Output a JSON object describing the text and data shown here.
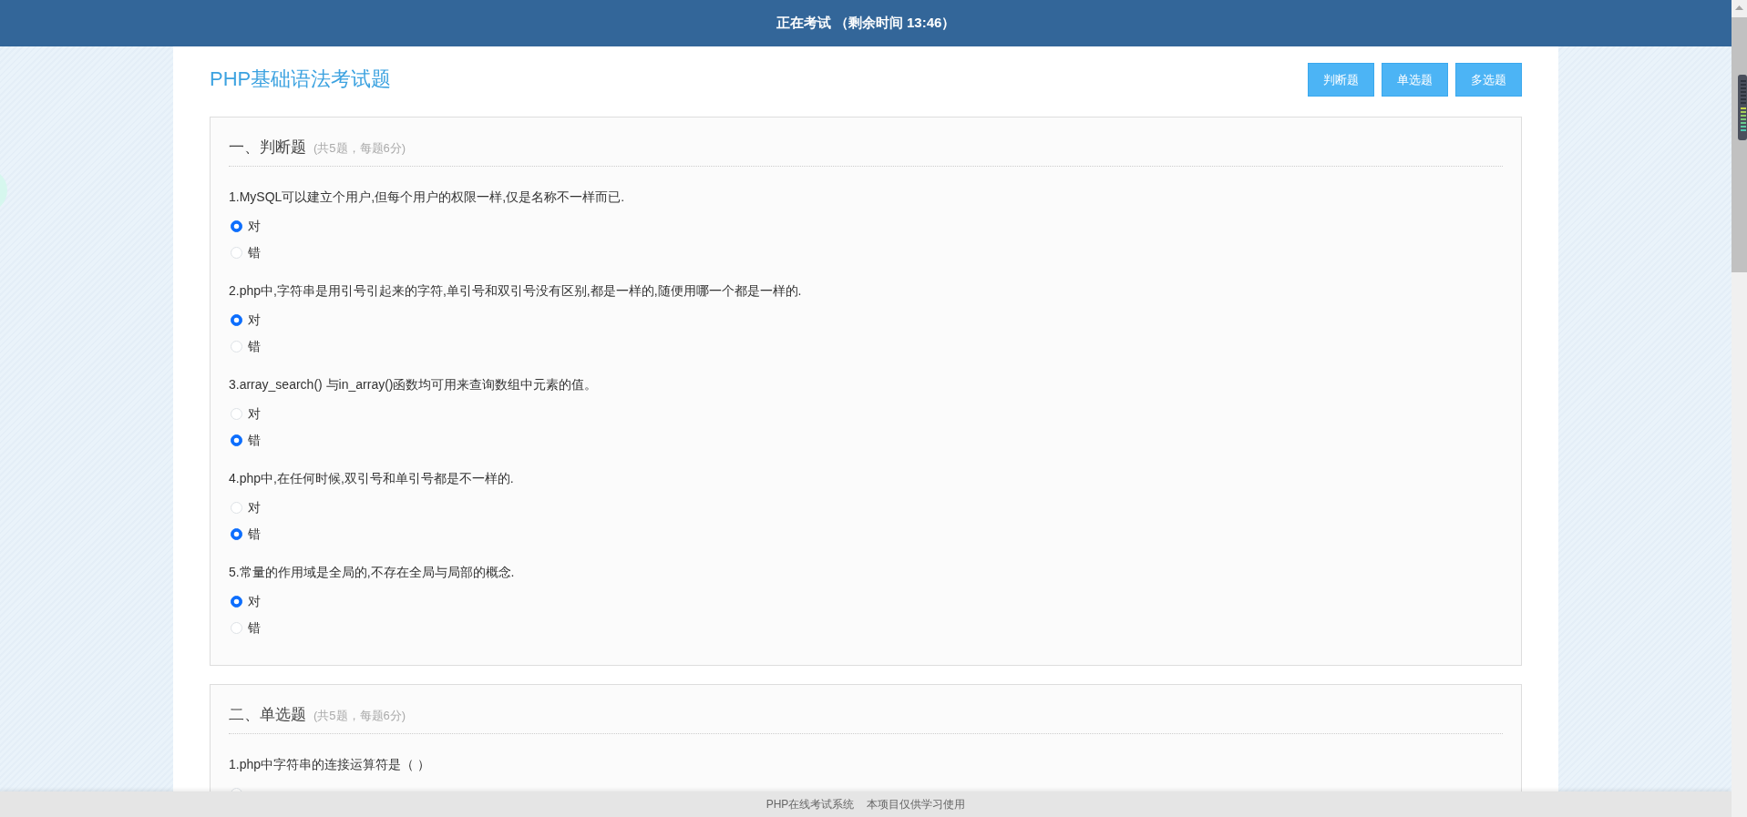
{
  "header": {
    "status": "正在考试 （剩余时间 13:46）"
  },
  "title": "PHP基础语法考试题",
  "nav_buttons": [
    "判断题",
    "单选题",
    "多选题"
  ],
  "sections": [
    {
      "heading": "一、判断题",
      "note": "(共5题，每题6分)",
      "questions": [
        {
          "text": "1.MySQL可以建立个用户,但每个用户的权限一样,仅是名称不一样而已.",
          "options": [
            {
              "label": "对",
              "selected": true
            },
            {
              "label": "错",
              "selected": false
            }
          ]
        },
        {
          "text": "2.php中,字符串是用引号引起来的字符,单引号和双引号没有区别,都是一样的,随便用哪一个都是一样的.",
          "options": [
            {
              "label": "对",
              "selected": true
            },
            {
              "label": "错",
              "selected": false
            }
          ]
        },
        {
          "text": "3.array_search() 与in_array()函数均可用来查询数组中元素的值。",
          "options": [
            {
              "label": "对",
              "selected": false
            },
            {
              "label": "错",
              "selected": true
            }
          ]
        },
        {
          "text": "4.php中,在任何时候,双引号和单引号都是不一样的.",
          "options": [
            {
              "label": "对",
              "selected": false
            },
            {
              "label": "错",
              "selected": true
            }
          ]
        },
        {
          "text": "5.常量的作用域是全局的,不存在全局与局部的概念.",
          "options": [
            {
              "label": "对",
              "selected": true
            },
            {
              "label": "错",
              "selected": false
            }
          ]
        }
      ]
    },
    {
      "heading": "二、单选题",
      "note": "(共5题，每题6分)",
      "questions": [
        {
          "text": "1.php中字符串的连接运算符是（ ）",
          "options": [
            {
              "selected": false
            }
          ]
        }
      ]
    }
  ],
  "footer": [
    "PHP在线考试系统",
    "本项目仅供学习使用"
  ]
}
